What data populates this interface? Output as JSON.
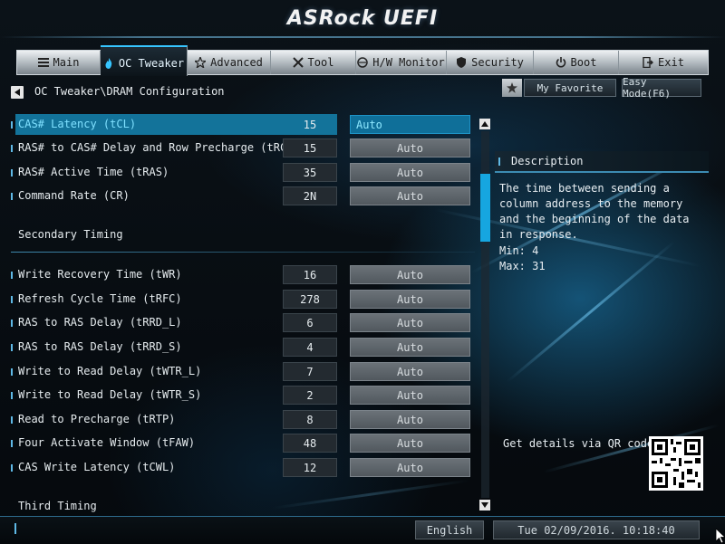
{
  "brand": "ASRock UEFI",
  "tabs": [
    {
      "label": "Main",
      "icon": "list-icon",
      "active": false
    },
    {
      "label": "OC Tweaker",
      "icon": "flame-icon",
      "active": true
    },
    {
      "label": "Advanced",
      "icon": "star-icon",
      "active": false
    },
    {
      "label": "Tool",
      "icon": "tools-icon",
      "active": false
    },
    {
      "label": "H/W Monitor",
      "icon": "monitor-icon",
      "active": false
    },
    {
      "label": "Security",
      "icon": "shield-icon",
      "active": false
    },
    {
      "label": "Boot",
      "icon": "power-icon",
      "active": false
    },
    {
      "label": "Exit",
      "icon": "exit-icon",
      "active": false
    }
  ],
  "breadcrumb": "OC Tweaker\\DRAM Configuration",
  "buttons": {
    "favorite": "My Favorite",
    "easy_mode": "Easy Mode(F6)"
  },
  "settings": [
    {
      "label": "CAS# Latency (tCL)",
      "current": "15",
      "value": "Auto",
      "highlighted": true
    },
    {
      "label": "RAS# to CAS# Delay and Row Precharge (tRCDtRP)",
      "current": "15",
      "value": "Auto"
    },
    {
      "label": "RAS# Active Time (tRAS)",
      "current": "35",
      "value": "Auto"
    },
    {
      "label": "Command Rate (CR)",
      "current": "2N",
      "value": "Auto"
    }
  ],
  "section_secondary": "Secondary Timing",
  "secondary_settings": [
    {
      "label": "Write Recovery Time (tWR)",
      "current": "16",
      "value": "Auto"
    },
    {
      "label": "Refresh Cycle Time (tRFC)",
      "current": "278",
      "value": "Auto"
    },
    {
      "label": "RAS to RAS Delay (tRRD_L)",
      "current": "6",
      "value": "Auto"
    },
    {
      "label": "RAS to RAS Delay (tRRD_S)",
      "current": "4",
      "value": "Auto"
    },
    {
      "label": "Write to Read Delay (tWTR_L)",
      "current": "7",
      "value": "Auto"
    },
    {
      "label": "Write to Read Delay (tWTR_S)",
      "current": "2",
      "value": "Auto"
    },
    {
      "label": "Read to Precharge (tRTP)",
      "current": "8",
      "value": "Auto"
    },
    {
      "label": "Four Activate Window (tFAW)",
      "current": "48",
      "value": "Auto"
    },
    {
      "label": "CAS Write Latency (tCWL)",
      "current": "12",
      "value": "Auto"
    }
  ],
  "section_third": "Third Timing",
  "description": {
    "title": "Description",
    "text": "The time between sending a column address to the memory and the beginning of the data in response.",
    "min": "Min: 4",
    "max": "Max: 31",
    "qr_label": "Get details via QR code"
  },
  "footer": {
    "language": "English",
    "datetime": "Tue 02/09/2016. 10:18:40"
  },
  "colors": {
    "accent": "#16a6e0",
    "highlight": "#13739a",
    "tab_active_border": "#36c5ff"
  }
}
